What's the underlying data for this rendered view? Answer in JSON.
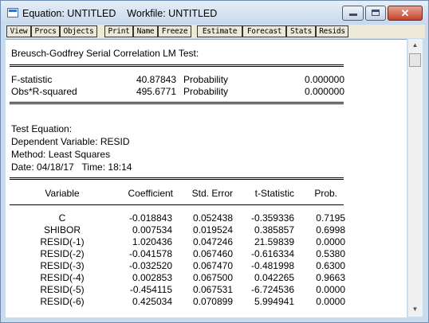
{
  "window": {
    "title": "Equation: UNTITLED    Workfile: UNTITLED",
    "close_glyph": "✕"
  },
  "toolbar": [
    "View",
    "Procs",
    "Objects",
    "Print",
    "Name",
    "Freeze",
    "Estimate",
    "Forecast",
    "Stats",
    "Resids"
  ],
  "output": {
    "test_title": "Breusch-Godfrey Serial Correlation LM Test:",
    "stats": [
      {
        "name": "F-statistic",
        "value": "40.87843",
        "prob_label": "Probability",
        "prob": "0.000000"
      },
      {
        "name": "Obs*R-squared",
        "value": "495.6771",
        "prob_label": "Probability",
        "prob": "0.000000"
      }
    ],
    "test_equation": "Test Equation:",
    "dependent": "Dependent Variable: RESID",
    "method": "Method: Least Squares",
    "date": "Date: 04/18/17   Time: 18:14",
    "headers": {
      "variable": "Variable",
      "coefficient": "Coefficient",
      "std_error": "Std. Error",
      "t_stat": "t-Statistic",
      "prob": "Prob."
    },
    "rows": [
      {
        "variable": "C",
        "coefficient": "-0.018843",
        "std_error": "0.052438",
        "t_stat": "-0.359336",
        "prob": "0.7195"
      },
      {
        "variable": "SHIBOR",
        "coefficient": "0.007534",
        "std_error": "0.019524",
        "t_stat": "0.385857",
        "prob": "0.6998"
      },
      {
        "variable": "RESID(-1)",
        "coefficient": "1.020436",
        "std_error": "0.047246",
        "t_stat": "21.59839",
        "prob": "0.0000"
      },
      {
        "variable": "RESID(-2)",
        "coefficient": "-0.041578",
        "std_error": "0.067460",
        "t_stat": "-0.616334",
        "prob": "0.5380"
      },
      {
        "variable": "RESID(-3)",
        "coefficient": "-0.032520",
        "std_error": "0.067470",
        "t_stat": "-0.481998",
        "prob": "0.6300"
      },
      {
        "variable": "RESID(-4)",
        "coefficient": "0.002853",
        "std_error": "0.067500",
        "t_stat": "0.042265",
        "prob": "0.9663"
      },
      {
        "variable": "RESID(-5)",
        "coefficient": "-0.454115",
        "std_error": "0.067531",
        "t_stat": "-6.724536",
        "prob": "0.0000"
      },
      {
        "variable": "RESID(-6)",
        "coefficient": "0.425034",
        "std_error": "0.070899",
        "t_stat": "5.994941",
        "prob": "0.0000"
      }
    ]
  },
  "scrollbar": {
    "up_glyph": "▲",
    "down_glyph": "▼"
  }
}
